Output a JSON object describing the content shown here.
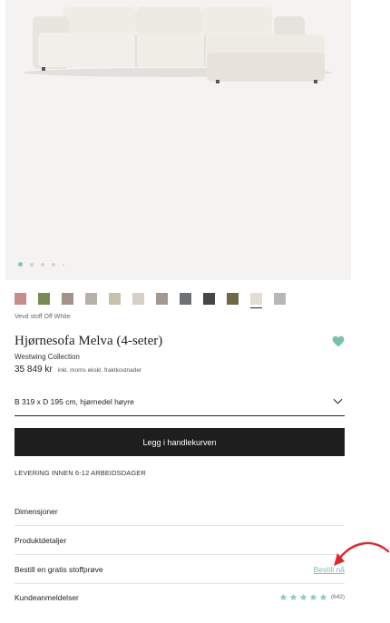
{
  "gallery": {
    "slides": 5,
    "active_slide": 1
  },
  "swatches": [
    {
      "name": "swatch-rose",
      "color": "#c68e8a"
    },
    {
      "name": "swatch-olive",
      "color": "#7b8a52"
    },
    {
      "name": "swatch-taupe",
      "color": "#a3938a"
    },
    {
      "name": "swatch-greige",
      "color": "#b4b1a8"
    },
    {
      "name": "swatch-sand",
      "color": "#c8c0ad"
    },
    {
      "name": "swatch-cream",
      "color": "#d6d1c4"
    },
    {
      "name": "swatch-mushroom",
      "color": "#a39790"
    },
    {
      "name": "swatch-slate",
      "color": "#6f7275"
    },
    {
      "name": "swatch-charcoal",
      "color": "#454648"
    },
    {
      "name": "swatch-moss",
      "color": "#6e6942"
    },
    {
      "name": "swatch-off-white",
      "color": "#e4ddd2",
      "selected": true
    },
    {
      "name": "swatch-light-grey",
      "color": "#b7b7b7"
    }
  ],
  "product": {
    "fabric_label": "Vevd stoff Off White",
    "title": "Hjørnesofa Melva (4-seter)",
    "brand": "Westwing Collection",
    "price": "35 849 kr",
    "price_note": "inkl. moms ekskl. fraktkostnader",
    "variant": "B 319 x D 195 cm, hjørnedel høyre"
  },
  "actions": {
    "add_to_cart": "Legg i handlekurven"
  },
  "delivery": "LEVERING INNEN 6-12 ARBEIDSDAGER",
  "rows": {
    "dimensions": "Dimensjoner",
    "details": "Produktdetaljer",
    "sample": "Bestill en gratis stoffprøve",
    "sample_link": "Bestill nå",
    "reviews": "Kundeanmeldelser",
    "review_count": "(642)",
    "rating_stars": 5
  },
  "colors": {
    "accent": "#78c2ad",
    "annotation_arrow": "#e0262b",
    "button_bg": "#1e1e1e"
  }
}
